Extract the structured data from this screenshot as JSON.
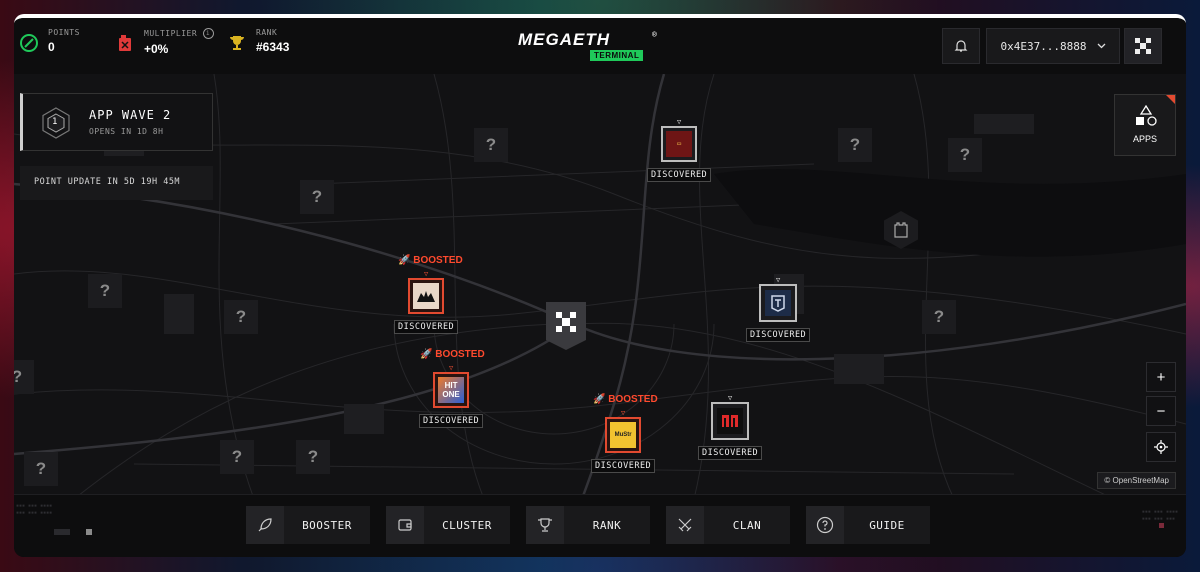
{
  "header": {
    "points_label": "POINTS",
    "points_value": "0",
    "multiplier_label": "MULTIPLIER",
    "multiplier_value": "+0%",
    "rank_label": "RANK",
    "rank_value": "#6343",
    "logo_text": "MEGAETH",
    "logo_sub": "TERMINAL",
    "logo_reg": "®",
    "wallet": "0x4E37...8888"
  },
  "wave": {
    "title": "APP WAVE 2",
    "subtitle": "OPENS IN 1D 8H",
    "badge": "1"
  },
  "point_update": "POINT UPDATE IN 5D 19H 45M",
  "apps_label": "APPS",
  "pins": [
    {
      "status": "DISCOVERED",
      "boost": ""
    },
    {
      "status": "DISCOVERED",
      "boost": "BOOSTED"
    },
    {
      "status": "DISCOVERED",
      "boost": "BOOSTED"
    },
    {
      "status": "DISCOVERED",
      "boost": "BOOSTED"
    },
    {
      "status": "DISCOVERED",
      "boost": ""
    },
    {
      "status": "DISCOVERED",
      "boost": ""
    }
  ],
  "pin_marks": {
    "hitone": "HIT ONE",
    "mustr": "MuStr"
  },
  "unknown_mark": "?",
  "zoom_in": "+",
  "zoom_out": "−",
  "osm_label": "OpenStreetMap",
  "nav": [
    {
      "label": "BOOSTER",
      "icon": "rocket-icon"
    },
    {
      "label": "CLUSTER",
      "icon": "wallet-icon"
    },
    {
      "label": "RANK",
      "icon": "trophy-icon"
    },
    {
      "label": "CLAN",
      "icon": "swords-icon"
    },
    {
      "label": "GUIDE",
      "icon": "question-icon"
    }
  ],
  "colors": {
    "accent": "#1fc95a",
    "boost": "#ff4a2e",
    "pin_red": "#e24a30"
  }
}
